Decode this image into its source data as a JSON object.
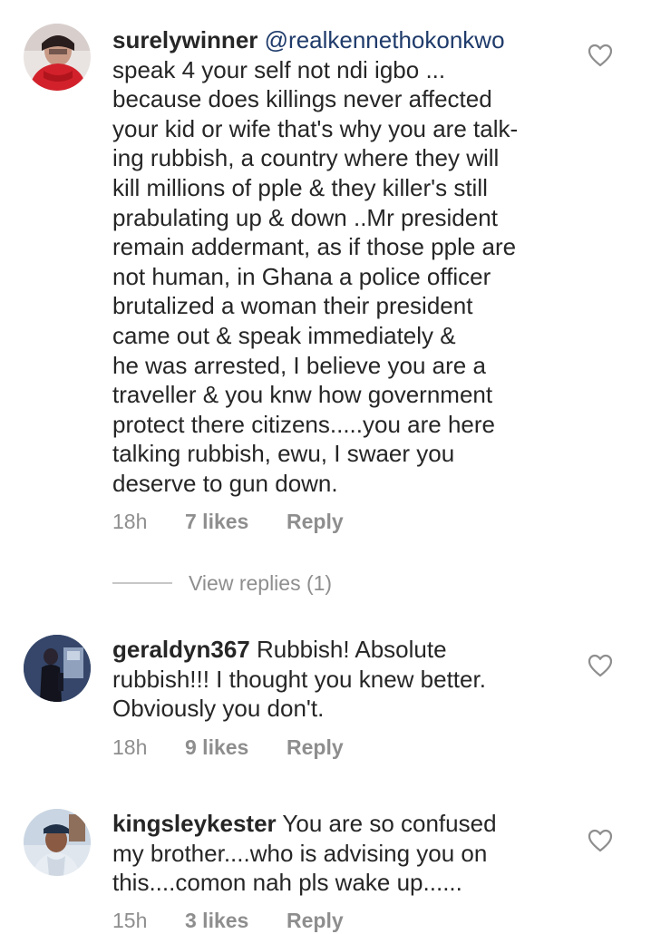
{
  "comments": [
    {
      "username": "surelywinner",
      "mention": "@realkennethokonkwo",
      "text_line1": " speak 4 your self not ndi igbo ...",
      "text_rest": "because  does killings  never affected\nyour kid or wife  that's why you are talk-\ning rubbish, a country  where they will\nkill millions  of pple & they killer's still\nprabulating  up & down ..Mr president\nremain  addermant, as if those pple are\nnot human, in Ghana a police officer\nbrutalized  a woman  their president\ncame out & speak immediately &\nhe was arrested, I believe  you are a\ntraveller & you knw  how government\nprotect there citizens.....you are here\ntalking rubbish,  ewu,  I swaer  you\ndeserve  to gun down.",
      "time": "18h",
      "likes": "7 likes",
      "reply": "Reply",
      "view_replies": "View replies (1)"
    },
    {
      "username": "geraldyn367",
      "text": " Rubbish! Absolute\nrubbish!!! I thought you knew better.\nObviously you don't.",
      "time": "18h",
      "likes": "9 likes",
      "reply": "Reply"
    },
    {
      "username": "kingsleykester",
      "text": " You are so confused\nmy brother....who is advising you on\nthis....comon nah pls wake up......",
      "time": "15h",
      "likes": "3 likes",
      "reply": "Reply"
    }
  ],
  "icons": {
    "like": "heart-outline-icon"
  }
}
